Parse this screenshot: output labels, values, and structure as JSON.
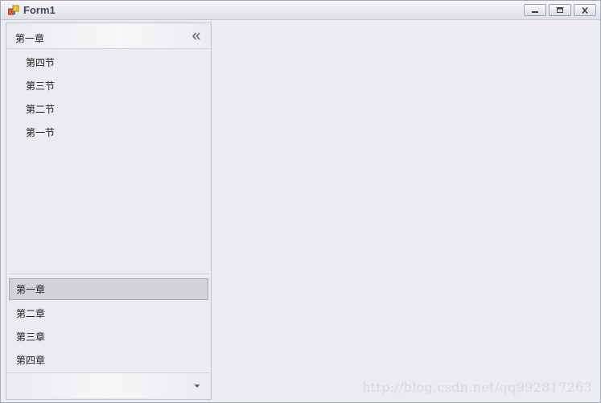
{
  "window": {
    "title": "Form1"
  },
  "nav": {
    "expanded_group": {
      "label": "第一章",
      "items": [
        {
          "label": "第四节"
        },
        {
          "label": "第三节"
        },
        {
          "label": "第二节"
        },
        {
          "label": "第一节"
        }
      ]
    },
    "groups": [
      {
        "label": "第一章",
        "selected": true
      },
      {
        "label": "第二章",
        "selected": false
      },
      {
        "label": "第三章",
        "selected": false
      },
      {
        "label": "第四章",
        "selected": false
      }
    ]
  },
  "watermark": "http://blog.csdn.net/qq992817263",
  "icons": {
    "app": "form-app-icon",
    "collapse": "double-chevron-left-icon",
    "overflow": "dropdown-arrow-icon",
    "minimize": "minimize-icon",
    "maximize": "maximize-icon",
    "close": "close-icon"
  },
  "colors": {
    "window_bg": "#ebecf0",
    "selected_group_bg": "#d2d3d9",
    "border": "#bfc2ca"
  }
}
